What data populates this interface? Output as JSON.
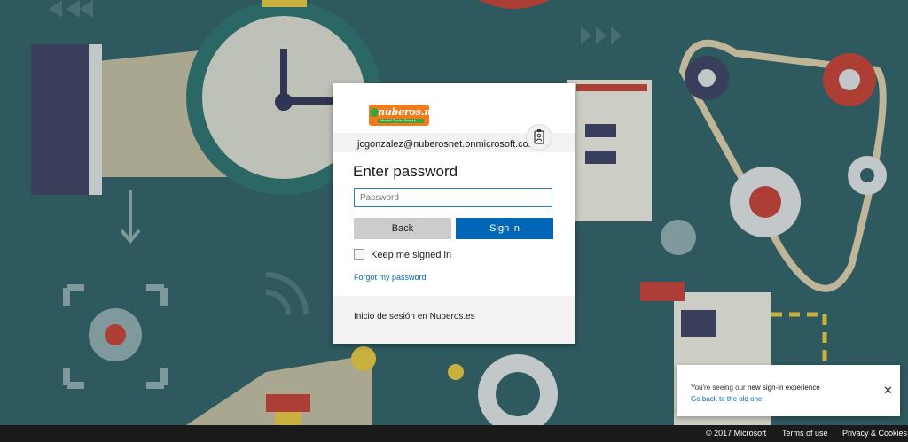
{
  "signin": {
    "logo_text": "nuberos.net",
    "logo_sub": "Microsoft Partner Network",
    "email": "jcgonzalez@nuberosnet.onmicrosoft.com",
    "title": "Enter password",
    "password_placeholder": "Password",
    "back_label": "Back",
    "signin_label": "Sign in",
    "keep_signed_in": "Keep me signed in",
    "forgot_password": "Forgot my password",
    "org_text": "Inicio de sesión en Nuberos.es"
  },
  "toast": {
    "message_prefix": "You're seeing our ",
    "message_emphasis": "new sign-in experience",
    "link": "Go back to the old one"
  },
  "footer": {
    "copyright": "© 2017 Microsoft",
    "terms": "Terms of use",
    "privacy": "Privacy & Cookies"
  },
  "colors": {
    "background": "#2e5a5f",
    "accent": "#0067b8",
    "logo": "#f07c1e"
  }
}
